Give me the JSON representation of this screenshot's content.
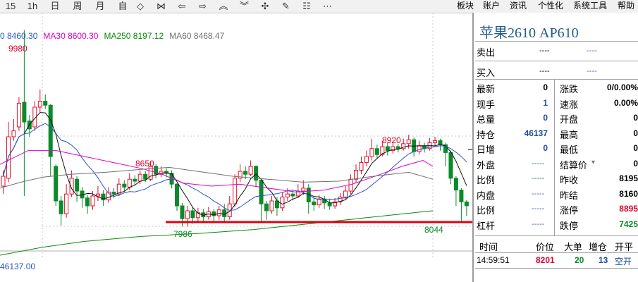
{
  "toolbar": {
    "left_items": [
      "15",
      "1h",
      "日",
      "周",
      "月",
      "自"
    ],
    "nav_icons": [
      "expand-horizontal-icon",
      "shrink-horizontal-icon",
      "arrow-left-icon",
      "arrow-right-icon",
      "double-up-icon",
      "double-down-icon",
      "crosshair-icon",
      "pencil-icon",
      "checklist-icon",
      "more-icon"
    ],
    "menus": [
      "板块",
      "账户",
      "资讯",
      "个性化",
      "系统工具",
      "帮助"
    ]
  },
  "ma_legend": [
    {
      "label": "0 8460.30",
      "color": "#2a54c8"
    },
    {
      "label": "MA30 8600.30",
      "color": "#e000c8"
    },
    {
      "label": "MA250 8197.12",
      "color": "#0a8a0a"
    },
    {
      "label": "MA60 8468.47",
      "color": "#707070"
    }
  ],
  "chart_data": {
    "type": "candlestick",
    "annotations": [
      {
        "label": "9980",
        "value": 9980
      },
      {
        "label": "8920",
        "value": 8920
      },
      {
        "label": "8650",
        "value": 8650
      },
      {
        "label": "7986",
        "value": 7986
      },
      {
        "label": "8044",
        "value": 8044
      }
    ],
    "footer_text": "46137.00"
  },
  "panel": {
    "title": "苹果2610  AP610",
    "sell_label": "卖出",
    "buy_label": "买入",
    "dash": "----",
    "rows_left": [
      {
        "label": "最新",
        "value": "0",
        "color": "black"
      },
      {
        "label": "现手",
        "value": "1",
        "color": "blue"
      },
      {
        "label": "总量",
        "value": "0",
        "color": "blue"
      },
      {
        "label": "持仓",
        "value": "46137",
        "color": "blue"
      },
      {
        "label": "日增",
        "value": "0",
        "color": "blue"
      },
      {
        "label": "外盘",
        "value": "-----",
        "color": "dash"
      },
      {
        "label": "比例",
        "value": "-----",
        "color": "dash"
      },
      {
        "label": "内盘",
        "value": "-----",
        "color": "dash"
      },
      {
        "label": "比例",
        "value": "-----",
        "color": "dash"
      },
      {
        "label": "杠杆",
        "value": "-----",
        "color": "dash"
      }
    ],
    "rows_right": [
      {
        "label": "涨跌",
        "value": "0/0.00%",
        "color": "black"
      },
      {
        "label": "速涨",
        "value": "0.00%",
        "color": "black"
      },
      {
        "label": "开盘",
        "value": "0",
        "color": "black"
      },
      {
        "label": "最高",
        "value": "0",
        "color": "black"
      },
      {
        "label": "最低",
        "value": "0",
        "color": "black"
      },
      {
        "label": "结算价",
        "value": "0",
        "color": "black"
      },
      {
        "label": "昨收",
        "value": "8195",
        "color": "black"
      },
      {
        "label": "昨结",
        "value": "8160",
        "color": "black"
      },
      {
        "label": "涨停",
        "value": "8895",
        "color": "red"
      },
      {
        "label": "跌停",
        "value": "7425",
        "color": "green"
      }
    ],
    "tick_header": [
      "时间",
      "价位",
      "大单",
      "增仓",
      "开平"
    ],
    "tick_row": {
      "time": "14:59:51",
      "price": "8201",
      "big": "20",
      "oi": "13",
      "type": "空开"
    }
  }
}
